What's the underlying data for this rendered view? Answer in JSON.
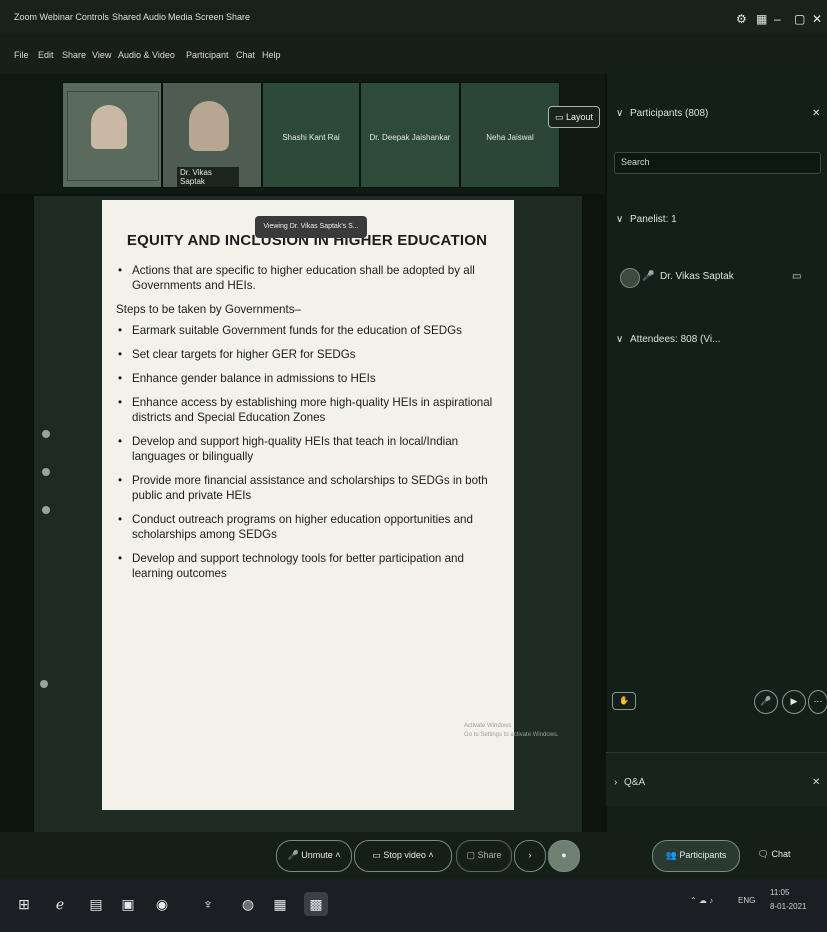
{
  "window": {
    "tabs": [
      "Zoom Webinar Controls",
      "Shared Audio",
      "Media Screen Share"
    ],
    "controls": [
      "minimize",
      "restore",
      "close"
    ]
  },
  "menu": [
    "File",
    "Edit",
    "Share",
    "View",
    "Audio & Video",
    "Participant",
    "Chat",
    "Help"
  ],
  "video_strip": {
    "tiles": [
      {
        "name": ""
      },
      {
        "name": "Dr. Vikas Saptak"
      },
      {
        "name": "Shashi Kant Rai"
      },
      {
        "name": "Dr. Deepak Jaishankar"
      },
      {
        "name": "Neha Jaiswal"
      }
    ],
    "layout_button": "Layout"
  },
  "shared_screen": {
    "viewing_label": "Viewing Dr. Vikas Saptak's S...",
    "slide": {
      "title": "EQUITY AND INCLUSION IN HIGHER EDUCATION",
      "intro_bullet": "Actions that are specific to higher education shall be adopted by all Governments and HEIs.",
      "steps_heading": "Steps to be taken by Governments–",
      "bullets": [
        "Earmark suitable Government funds for the education of SEDGs",
        "Set clear targets for higher GER for SEDGs",
        "Enhance gender balance in admissions to HEIs",
        "Enhance access by establishing more high-quality HEIs in aspirational districts and Special Education Zones",
        "Develop and support high-quality HEIs that teach in local/Indian languages or bilingually",
        "Provide more financial assistance and scholarships to SEDGs in both public and private HEIs",
        "Conduct outreach programs on higher education opportunities and scholarships among SEDGs",
        "Develop and support technology tools for better participation and learning outcomes"
      ]
    },
    "watermark": "Activate Windows\nGo to Settings to activate Windows."
  },
  "participants_panel": {
    "header": "Participants (808)",
    "search_placeholder": "Search",
    "panelists_label": "Panelist: 1",
    "panelist_name": "Dr. Vikas Saptak",
    "attendees_label": "Attendees: 808 (Vi..."
  },
  "qa_panel": {
    "label": "Q&A"
  },
  "controls": {
    "unmute": "Unmute",
    "stop_video": "Stop video",
    "share": "Share",
    "participants": "Participants",
    "chat": "Chat"
  },
  "taskbar": {
    "time": "11:05",
    "date": "8-01-2021",
    "lang": "ENG"
  },
  "colors": {
    "panel_bg": "#122019",
    "slide_bg": "#f2f1ea",
    "text_light": "#d8e0d8"
  }
}
